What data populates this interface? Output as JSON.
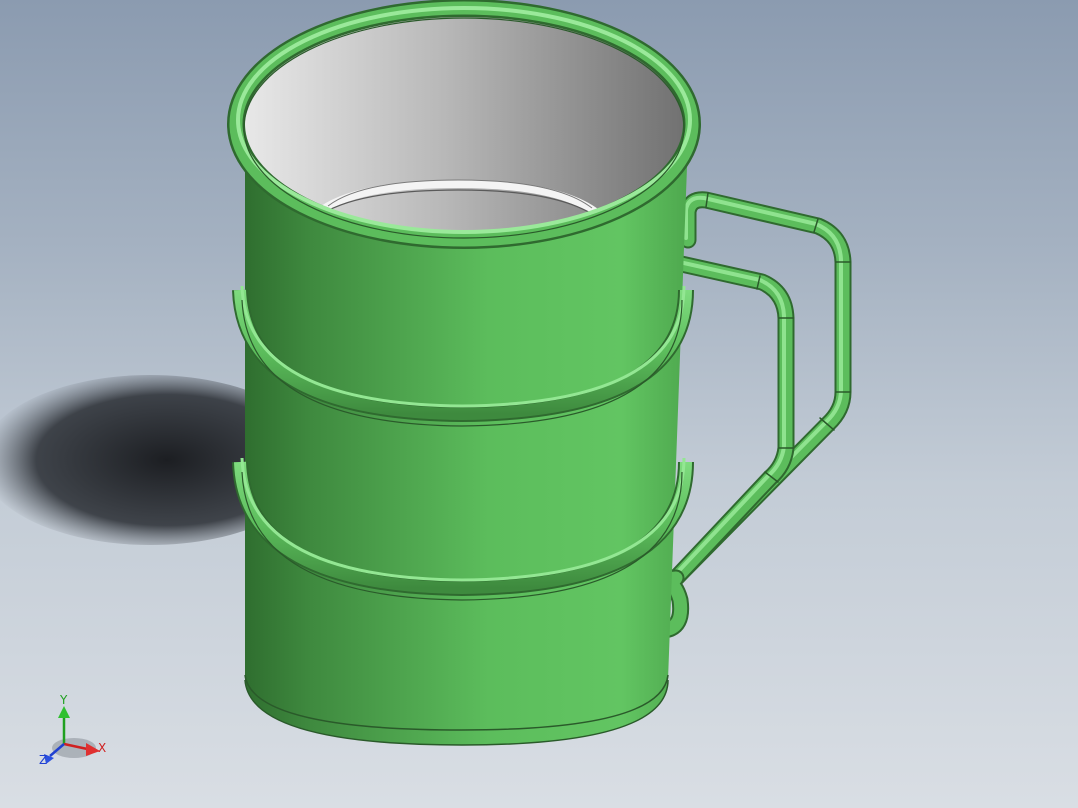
{
  "viewport": {
    "background_top": "#8b9bb0",
    "background_bottom": "#d9dee4"
  },
  "model": {
    "body_color": "#5cbd5c",
    "body_shadow_color": "#3a7d3a",
    "interior_color": "#b8b8b8",
    "shadow_color": "#2a2d32"
  },
  "triad": {
    "x_label": "X",
    "y_label": "Y",
    "z_label": "Z",
    "x_color": "#e02020",
    "y_color": "#20c020",
    "z_color": "#2040e0"
  }
}
